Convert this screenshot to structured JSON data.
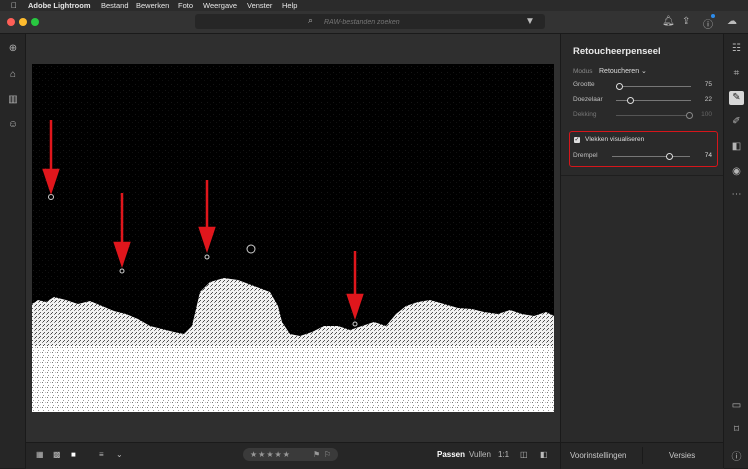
{
  "menu": {
    "apple": "",
    "app_name": "Adobe Lightroom",
    "items": [
      "Bestand",
      "Bewerken",
      "Foto",
      "Weergave",
      "Venster",
      "Help"
    ]
  },
  "search": {
    "placeholder": "RAW-bestanden zoeken"
  },
  "panel": {
    "title": "Retoucheerpenseel",
    "mode_label": "Modus",
    "mode_value": "Retoucheren",
    "sliders": [
      {
        "label": "Grootte",
        "value": "75",
        "fraction": 0.03,
        "dimmed": false
      },
      {
        "label": "Doezelaar",
        "value": "22",
        "fraction": 0.22,
        "dimmed": false
      },
      {
        "label": "Dekking",
        "value": "100",
        "fraction": 1.0,
        "dimmed": true
      }
    ],
    "visualize_label": "Vlekken visualiseren",
    "visualize_checked": true,
    "threshold_label": "Drempel",
    "threshold_value": "74",
    "threshold_fraction": 0.74
  },
  "bottom": {
    "fit_label": "Passen",
    "fill_label": "Vullen",
    "ratio_label": "1:1",
    "presets_label": "Voorinstellingen",
    "versions_label": "Versies",
    "stars": "★★★★★"
  },
  "colors": {
    "highlight_box": "#d6161b",
    "arrow": "#e0161c",
    "accent": "#2d8ceb"
  }
}
